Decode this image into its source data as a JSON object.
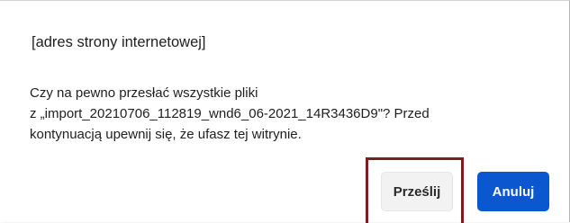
{
  "dialog": {
    "site_title": "[adres strony internetowej]",
    "message_lines": [
      "Czy na pewno przesłać wszystkie pliki",
      "z „import_20210706_112819_wnd6_06-2021_14R3436D9\"? Przed",
      "kontynuacją upewnij się, że ufasz tej witrynie."
    ],
    "buttons": {
      "submit_label": "Prześlij",
      "cancel_label": "Anuluj"
    }
  },
  "colors": {
    "primary_button": "#0b57d0",
    "secondary_button": "#f2f2f2",
    "highlight_border": "#7a1f1f"
  }
}
